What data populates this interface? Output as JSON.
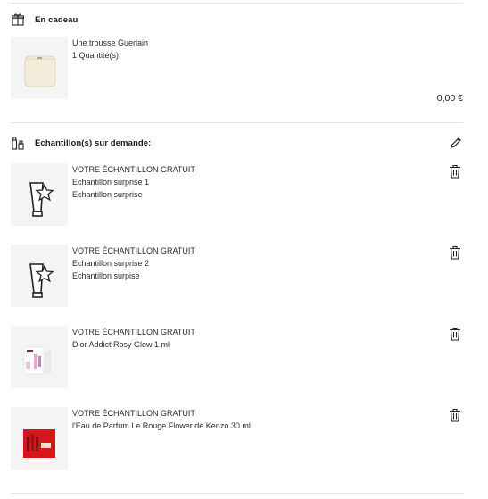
{
  "gift": {
    "title": "En cadeau",
    "icon": "gift-icon",
    "item": {
      "name": "Une trousse Guerlain",
      "quantity": "1 Quantité(s)",
      "price": "0,00 €"
    }
  },
  "samples": {
    "title": "Echantillon(s) sur demande:",
    "icon": "samples-icon",
    "items": [
      {
        "header": "VOTRE ÉCHANTILLON GRATUIT",
        "line1": "Echantillon surprise 1",
        "line2": "Echantillon surprise",
        "image": "tube-star-icon"
      },
      {
        "header": "VOTRE ÉCHANTILLON GRATUIT",
        "line1": "Echantillon surprise 2",
        "line2": "Echantillon surpise",
        "image": "tube-star-icon"
      },
      {
        "header": "VOTRE ÉCHANTILLON GRATUIT",
        "line1": "Dior Addict Rosy Glow 1 ml",
        "image": "dior-sample-card"
      },
      {
        "header": "VOTRE ÉCHANTILLON GRATUIT",
        "line1": "l'Eau de Parfum Le Rouge Flower de Kenzo 30 ml",
        "image": "kenzo-sample-card"
      }
    ]
  },
  "colors": {
    "divider": "#e3e3e3",
    "thumb_bg": "#f4f4f4",
    "text": "#1a1a1a"
  }
}
